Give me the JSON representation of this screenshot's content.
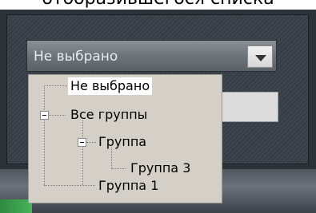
{
  "caption": "отобразившегося списка",
  "dropdown": {
    "value": "Не выбрано"
  },
  "tree": {
    "items": [
      {
        "label": "Не выбрано"
      },
      {
        "label": "Все группы"
      },
      {
        "label": "Группа"
      },
      {
        "label": "Группа 3"
      },
      {
        "label": "Группа 1"
      }
    ]
  }
}
